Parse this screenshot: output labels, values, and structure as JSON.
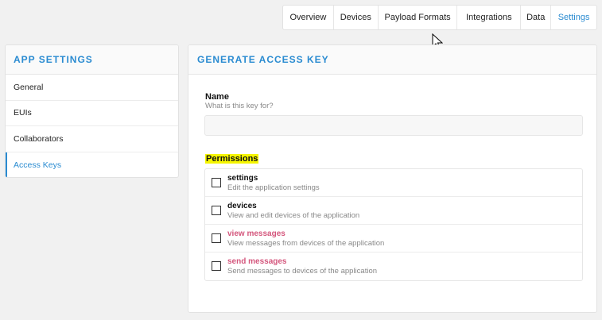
{
  "tabs": [
    {
      "label": "Overview",
      "width": 0
    },
    {
      "label": "Devices"
    },
    {
      "label": "Payload Formats"
    },
    {
      "label": "Integrations"
    },
    {
      "label": "Data"
    },
    {
      "label": "Settings",
      "active": true
    }
  ],
  "sidebar": {
    "title": "App Settings",
    "items": [
      {
        "label": "General"
      },
      {
        "label": "EUIs"
      },
      {
        "label": "Collaborators"
      },
      {
        "label": "Access Keys",
        "active": true
      }
    ]
  },
  "main": {
    "title": "Generate Access Key",
    "name_label": "Name",
    "name_help": "What is this key for?",
    "name_value": "",
    "permissions_heading": "Permissions",
    "permissions": [
      {
        "name": "settings",
        "description": "Edit the application settings"
      },
      {
        "name": "devices",
        "description": "View and edit devices of the application"
      },
      {
        "name": "view messages",
        "description": "View messages from devices of the application"
      },
      {
        "name": "send messages",
        "description": "Send messages to devices of the application"
      }
    ]
  },
  "colors": {
    "accent": "#2a8bd1",
    "highlight": "#f5f500",
    "warning_permission": "#d4567c"
  }
}
